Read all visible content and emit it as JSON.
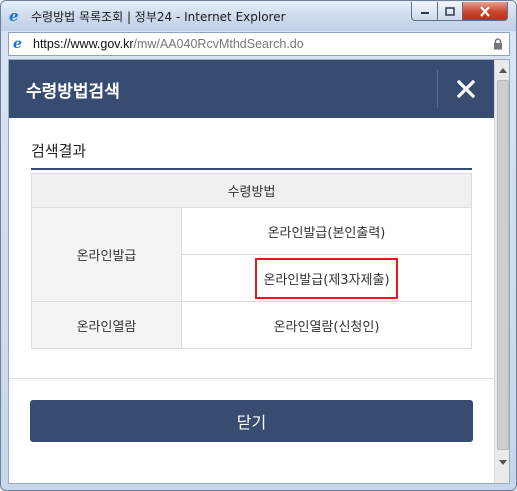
{
  "window": {
    "title": "수령방법 목록조회 | 정부24 - Internet Explorer"
  },
  "address": {
    "url_main": "https://www.gov.kr",
    "url_path": "/mw/AA040RcvMthdSearch.do"
  },
  "popup": {
    "title": "수령방법검색",
    "section_title": "검색결과",
    "table": {
      "header": "수령방법",
      "rows": [
        {
          "category": "온라인발급",
          "values": [
            "온라인발급(본인출력)",
            "온라인발급(제3자제출)"
          ]
        },
        {
          "category": "온라인열람",
          "values": [
            "온라인열람(신청인)"
          ]
        }
      ]
    },
    "close_button": "닫기"
  },
  "colors": {
    "header_bg": "#384c71",
    "highlight_border": "#e21a1a"
  },
  "icons": {
    "browser": "internet-explorer-icon",
    "lock": "lock-icon",
    "close": "close-x-icon"
  }
}
